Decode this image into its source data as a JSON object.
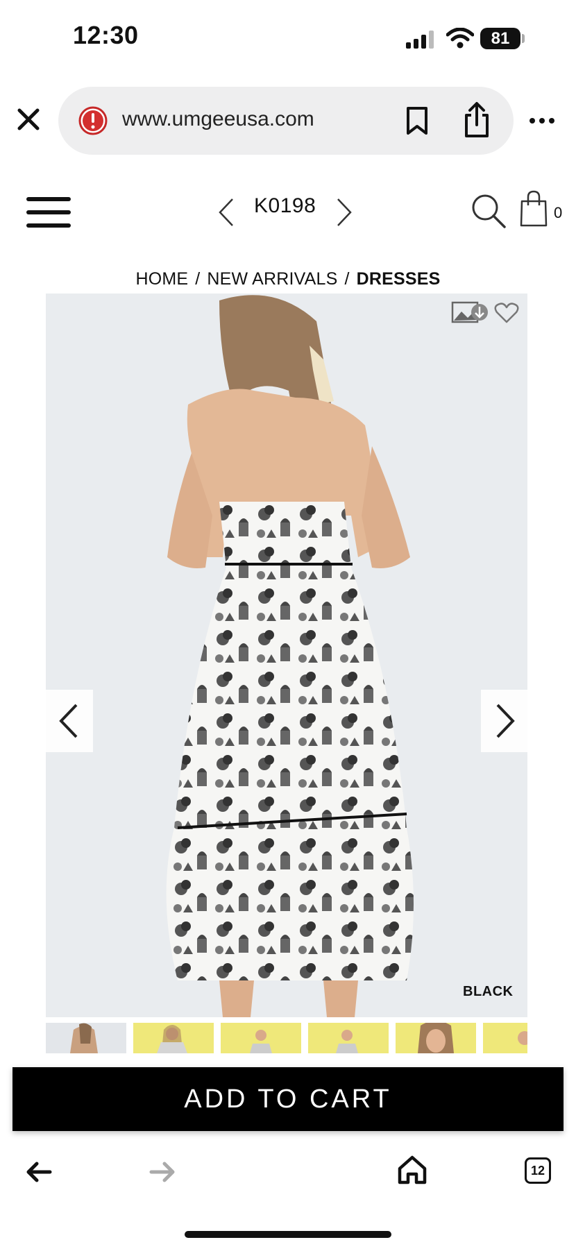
{
  "status_bar": {
    "time": "12:30",
    "battery": "81",
    "icons": [
      "signal-icon",
      "wifi-icon",
      "battery-icon"
    ]
  },
  "browser": {
    "url": "www.umgeeusa.com",
    "tabs_count": "12",
    "icons": [
      "close-icon",
      "warning-icon",
      "bookmark-icon",
      "share-icon",
      "more-icon",
      "back-arrow-icon",
      "forward-arrow-icon",
      "home-icon",
      "tabs-icon"
    ]
  },
  "header": {
    "sku": "K0198",
    "cart_count": "0",
    "icons": [
      "hamburger-menu-icon",
      "chevron-left-icon",
      "chevron-right-icon",
      "search-icon",
      "shopping-bag-icon"
    ]
  },
  "breadcrumb": {
    "items": [
      {
        "label": "HOME"
      },
      {
        "label": "NEW ARRIVALS"
      },
      {
        "label": "DRESSES"
      }
    ],
    "separator": "/"
  },
  "product": {
    "color_label": "BLACK",
    "thumbnail_count": 6
  },
  "actions": {
    "add_to_cart": "ADD TO CART"
  },
  "colors": {
    "accent": "#000000",
    "warning": "#d32f2f",
    "thumbnail_bg": "#efe87a"
  }
}
